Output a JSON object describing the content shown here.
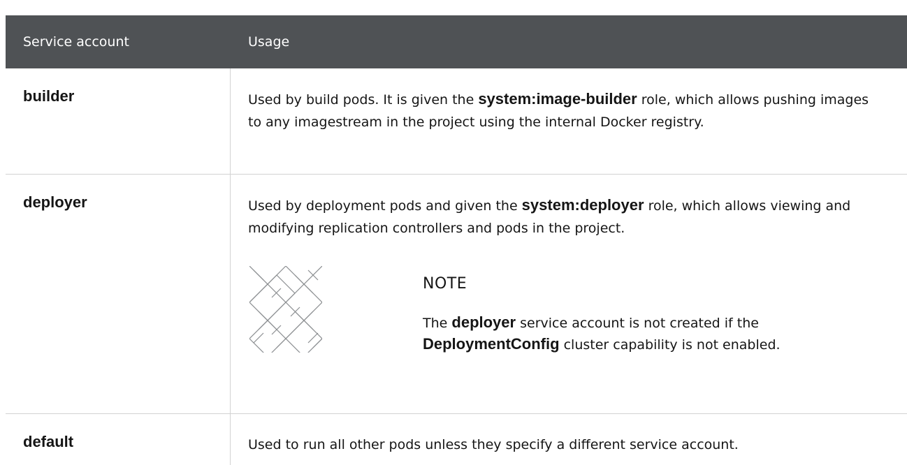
{
  "header": {
    "col1": "Service account",
    "col2": "Usage"
  },
  "rows": [
    {
      "name": "builder",
      "usage_pre": "Used by build pods. It is given the ",
      "usage_bold": "system:image-builder",
      "usage_post": " role, which allows pushing images to any imagestream in the project using the internal Docker registry."
    },
    {
      "name": "deployer",
      "usage_pre": "Used by deployment pods and given the ",
      "usage_bold": "system:deployer",
      "usage_post": " role, which allows viewing and modifying replication controllers and pods in the project.",
      "note": {
        "icon": "note-pattern-icon",
        "title": "NOTE",
        "pre": "The ",
        "bold1": "deployer",
        "mid": " service account is not created if the ",
        "bold2": "DeploymentConfig",
        "post": " cluster capability is not enabled."
      }
    },
    {
      "name": "default",
      "usage": "Used to run all other pods unless they specify a different service account."
    }
  ],
  "colors": {
    "header_bg": "#4f5255",
    "border": "#d2d2d2",
    "text": "#151515"
  }
}
